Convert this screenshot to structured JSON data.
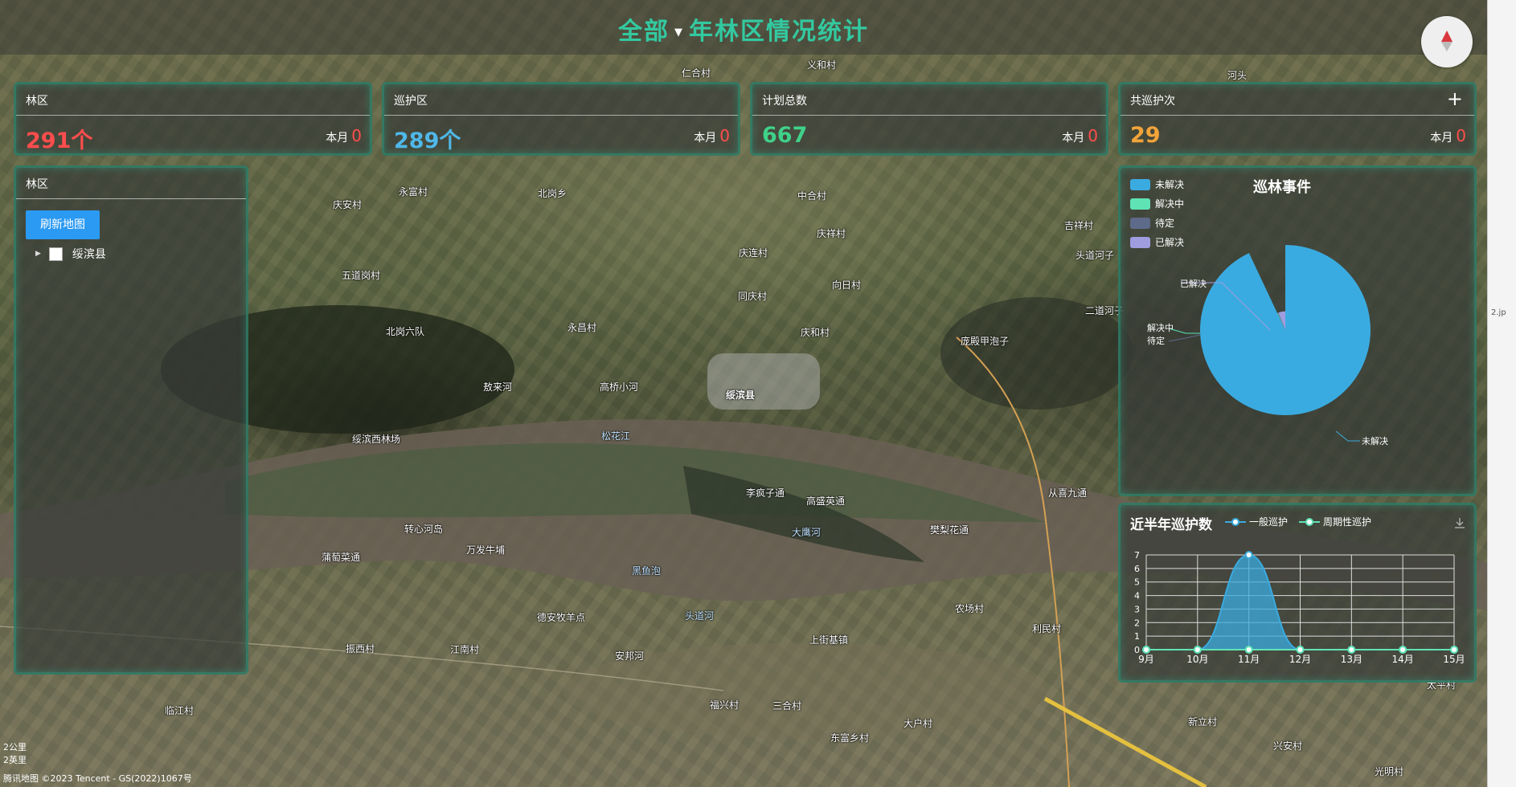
{
  "header": {
    "title_prefix": "全部",
    "title_main": "年林区情况统计"
  },
  "stats": [
    {
      "label": "林区",
      "value": "291个",
      "color": "#ff4d4d",
      "month_label": "本月",
      "month_value": "0"
    },
    {
      "label": "巡护区",
      "value": "289个",
      "color": "#4fb8e8",
      "month_label": "本月",
      "month_value": "0"
    },
    {
      "label": "计划总数",
      "value": "667",
      "color": "#3fd28a",
      "month_label": "本月",
      "month_value": "0"
    },
    {
      "label": "共巡护次",
      "value": "29",
      "color": "#f2a43a",
      "month_label": "本月",
      "month_value": "0"
    }
  ],
  "left_panel": {
    "title": "林区",
    "refresh_button": "刷新地图",
    "tree_item": "绥滨县"
  },
  "pie": {
    "title": "巡林事件",
    "legend": [
      {
        "name": "未解决",
        "color": "#3aabe0"
      },
      {
        "name": "解决中",
        "color": "#5fe3b5"
      },
      {
        "name": "待定",
        "color": "#5e6a8a"
      },
      {
        "name": "已解决",
        "color": "#9f9de0"
      }
    ],
    "callouts": {
      "resolved": "已解决",
      "resolving": "解决中",
      "pending": "待定",
      "unresolved": "未解决"
    }
  },
  "line": {
    "title": "近半年巡护数",
    "legend": [
      {
        "name": "一般巡护",
        "color": "#3aabe0"
      },
      {
        "name": "周期性巡护",
        "color": "#5fe3b5"
      }
    ]
  },
  "chart_data": [
    {
      "type": "pie",
      "title": "巡林事件",
      "categories": [
        "未解决",
        "解决中",
        "待定",
        "已解决"
      ],
      "values": [
        0.93,
        0.005,
        0.005,
        0.06
      ],
      "legend_position": "top-left"
    },
    {
      "type": "area",
      "title": "近半年巡护数",
      "categories": [
        "9月",
        "10月",
        "11月",
        "12月",
        "13月",
        "14月",
        "15月"
      ],
      "series": [
        {
          "name": "一般巡护",
          "values": [
            0,
            0,
            7,
            0,
            0,
            0,
            0
          ]
        },
        {
          "name": "周期性巡护",
          "values": [
            0,
            0,
            0,
            0,
            0,
            0,
            0
          ]
        }
      ],
      "yticks": [
        "0",
        "1",
        "2",
        "3",
        "4",
        "5",
        "6",
        "7"
      ],
      "ylim": [
        0,
        7
      ],
      "grid": true,
      "legend_position": "top"
    }
  ],
  "map": {
    "places": [
      {
        "name": "北岗乡"
      },
      {
        "name": "中合村"
      },
      {
        "name": "庆祥村"
      },
      {
        "name": "庆安村"
      },
      {
        "name": "永富村"
      },
      {
        "name": "五道岗村"
      },
      {
        "name": "庆连村"
      },
      {
        "name": "向日村"
      },
      {
        "name": "同庆村"
      },
      {
        "name": "永昌村"
      },
      {
        "name": "北岗六队"
      },
      {
        "name": "庆和村"
      },
      {
        "name": "敖来河"
      },
      {
        "name": "高桥小河"
      },
      {
        "name": "绥滨县"
      },
      {
        "name": "绥滨西林场"
      },
      {
        "name": "松花江"
      },
      {
        "name": "李疯子通"
      },
      {
        "name": "高盛英通"
      },
      {
        "name": "大鹰河"
      },
      {
        "name": "万发牛埔"
      },
      {
        "name": "蒲萄菜通"
      },
      {
        "name": "黑鱼泡"
      },
      {
        "name": "德安牧羊点"
      },
      {
        "name": "头道河"
      },
      {
        "name": "上街基镇"
      },
      {
        "name": "江南村"
      },
      {
        "name": "安邦河"
      },
      {
        "name": "吉祥村"
      },
      {
        "name": "庞殿甲泡子"
      },
      {
        "name": "头道河子"
      },
      {
        "name": "二道河子"
      },
      {
        "name": "从喜九通"
      },
      {
        "name": "樊梨花通"
      },
      {
        "name": "农场村"
      },
      {
        "name": "利民村"
      },
      {
        "name": "临江村"
      },
      {
        "name": "福兴村"
      },
      {
        "name": "三合村"
      },
      {
        "name": "东富乡村"
      },
      {
        "name": "大户村"
      },
      {
        "name": "新立村"
      },
      {
        "name": "兴安村"
      },
      {
        "name": "光明村"
      },
      {
        "name": "太平村"
      },
      {
        "name": "转心河岛"
      },
      {
        "name": "仁合村"
      },
      {
        "name": "义和村"
      },
      {
        "name": "河头"
      },
      {
        "name": "振西村"
      }
    ],
    "scale": {
      "km": "2公里",
      "mi": "2英里"
    },
    "attribution": "腾讯地图 ©2023 Tencent - GS(2022)1067号"
  },
  "right_strip": {
    "fragment": "2.jp"
  }
}
